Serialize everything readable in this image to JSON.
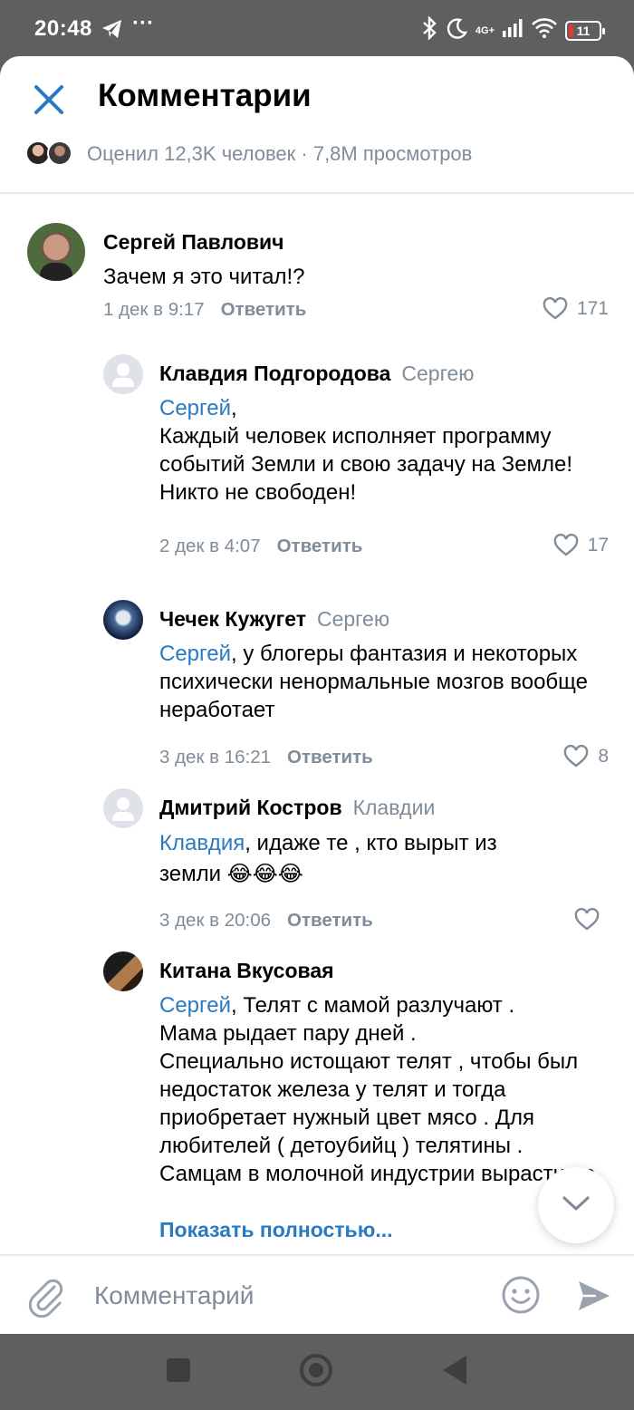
{
  "status_bar": {
    "time": "20:48",
    "dots": "···",
    "network": "4G+",
    "battery": "11"
  },
  "header": {
    "title": "Комментарии",
    "meta": "Оценил 12,3K человек · 7,8M просмотров"
  },
  "comments": [
    {
      "author": "Сергей Павлович",
      "reply_to": "",
      "text": "Зачем я это читал!?",
      "date": "1 дек в 9:17",
      "reply_label": "Ответить",
      "likes": "171"
    },
    {
      "author": "Клавдия Подгородова",
      "reply_to": "Сергею",
      "mention": "Сергей",
      "text": ",\nКаждый человек исполняет программу событий Земли и свою задачу на Земле!\nНикто не свободен!",
      "date": "2 дек в 4:07",
      "reply_label": "Ответить",
      "likes": "17"
    },
    {
      "author": "Чечек Кужугет",
      "reply_to": "Сергею",
      "mention": "Сергей",
      "text": ", у блогеры фантазия и некоторых психически ненормальные мозгов вообще неработает",
      "date": "3 дек в 16:21",
      "reply_label": "Ответить",
      "likes": "8"
    },
    {
      "author": "Дмитрий Костров",
      "reply_to": "Клавдии",
      "mention": "Клавдия",
      "text": ", идаже те , кто вырыт из земли 😂😂😂",
      "date": "3 дек в 20:06",
      "reply_label": "Ответить",
      "likes": ""
    },
    {
      "author": "Китана Вкусовая",
      "reply_to": "",
      "mention": "Сергей",
      "text": ", Телят с мамой разлучают .\nМама рыдает пару дней .\nСпециально истощают телят , чтобы был недостаток железа у телят и тогда приобретает нужный цвет мясо . Для любителей ( детоубийц ) телятины .\nСамцам в молочной индустрии вырасти не",
      "show_more": "Показать полностью..."
    }
  ],
  "composer": {
    "placeholder": "Комментарий"
  },
  "colors": {
    "accent": "#2a79c3",
    "secondary_text": "#818c99",
    "system_bars": "#5f5f5f"
  }
}
